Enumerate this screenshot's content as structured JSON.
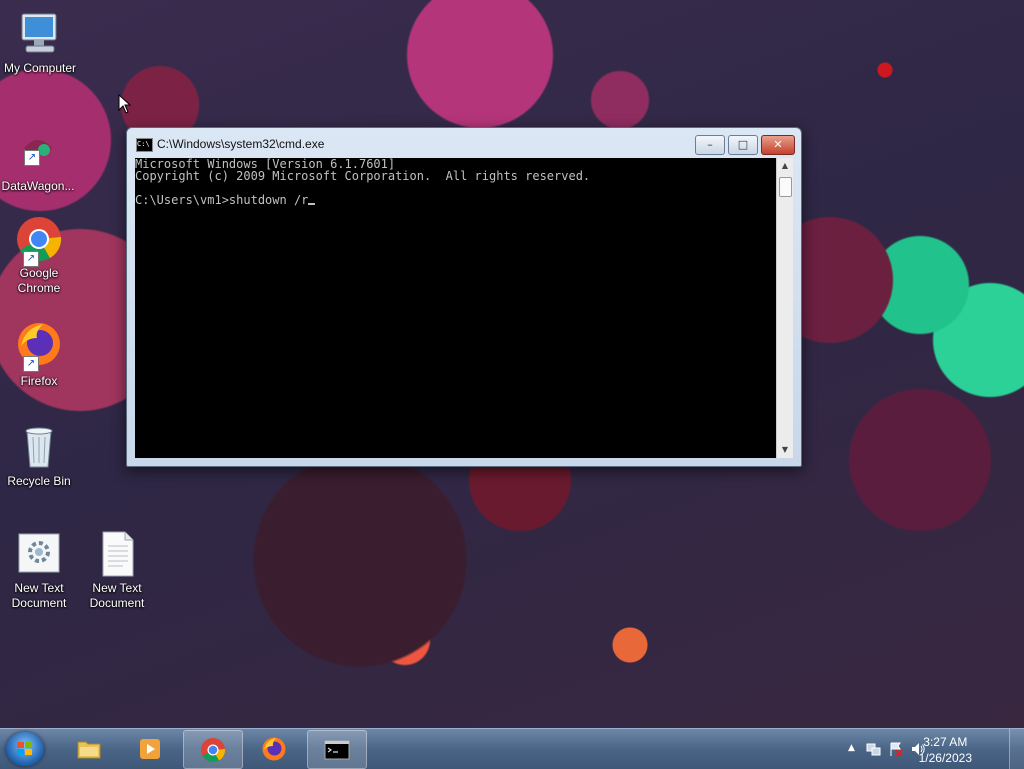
{
  "desktop": {
    "icons": [
      {
        "label": "My Computer"
      },
      {
        "label": "DataWagon..."
      },
      {
        "label": "Google Chrome"
      },
      {
        "label": "Firefox"
      },
      {
        "label": "Recycle Bin"
      },
      {
        "label": "New Text Document"
      },
      {
        "label": "New Text Document"
      }
    ]
  },
  "window": {
    "title": "C:\\Windows\\system32\\cmd.exe",
    "icon_text": "C:\\",
    "minimize": "–",
    "maximize": "□",
    "close": "✕",
    "console_lines": [
      "Microsoft Windows [Version 6.1.7601]",
      "Copyright (c) 2009 Microsoft Corporation.  All rights reserved.",
      "",
      "C:\\Users\\vm1>shutdown /r"
    ]
  },
  "taskbar": {
    "clock_time": "3:27 AM",
    "clock_date": "1/26/2023",
    "tray_arrow": "▲"
  },
  "colors": {
    "console_bg": "#000000",
    "console_fg": "#c0c0c0",
    "taskbar": "#4b6587",
    "close_button": "#c4422e"
  }
}
